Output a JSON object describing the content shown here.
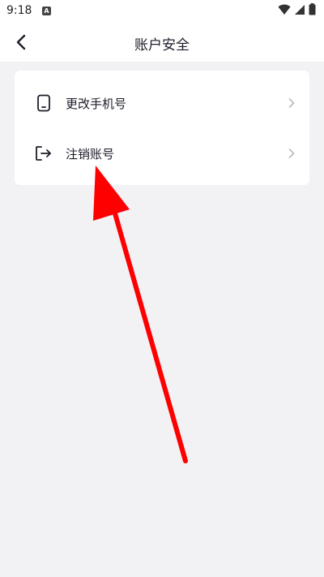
{
  "status_bar": {
    "time": "9:18",
    "app_badge": "A"
  },
  "header": {
    "title": "账户安全"
  },
  "menu": {
    "items": [
      {
        "label": "更改手机号",
        "icon": "phone-icon"
      },
      {
        "label": "注销账号",
        "icon": "logout-icon"
      }
    ]
  },
  "colors": {
    "background": "#f2f2f5",
    "card": "#ffffff",
    "text": "#1d1d2b",
    "chevron": "#b0b0b8",
    "annotation_arrow": "#ff0000"
  }
}
